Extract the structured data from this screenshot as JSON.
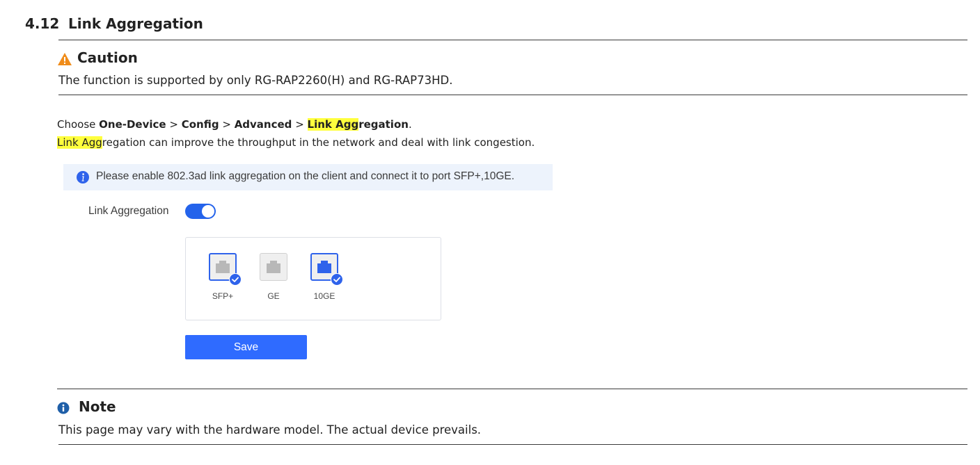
{
  "section": {
    "number": "4.12",
    "title": "Link Aggregation"
  },
  "caution": {
    "icon": "warning-triangle-icon",
    "title": "Caution",
    "text": "The function is supported by only RG-RAP2260(H) and RG-RAP73HD."
  },
  "instructions": {
    "choose": "Choose ",
    "path": [
      {
        "text": "One-Device",
        "highlight": ""
      },
      {
        "text": "Config",
        "highlight": ""
      },
      {
        "text": "Advanced",
        "highlight": ""
      }
    ],
    "separator": " > ",
    "last_highlighted": "Link Agg",
    "last_rest": "regation",
    "period": ".",
    "desc_highlighted": "Link Agg",
    "desc_rest": "regation can improve the throughput in the network and deal with link congestion."
  },
  "screenshot": {
    "info_icon": "info-circle-icon",
    "info_text": "Please enable 802.3ad link aggregation on the client and connect it to port SFP+,10GE.",
    "toggle_label": "Link Aggregation",
    "toggle_on": true,
    "ports": [
      {
        "label": "SFP+",
        "selected": true,
        "icon": "ethernet-port-icon"
      },
      {
        "label": "GE",
        "selected": false,
        "icon": "ethernet-port-icon"
      },
      {
        "label": "10GE",
        "selected": true,
        "icon": "ethernet-port-icon"
      }
    ],
    "save_label": "Save"
  },
  "note": {
    "icon": "info-circle-icon",
    "title": "Note",
    "text": "This page may vary with the hardware model. The actual device prevails."
  },
  "colors": {
    "highlight": "#ffff3d",
    "accent_blue": "#2f6bff",
    "toggle_blue": "#2463eb",
    "caution_orange": "#f08c1a",
    "note_blue": "#1f5fa8"
  }
}
